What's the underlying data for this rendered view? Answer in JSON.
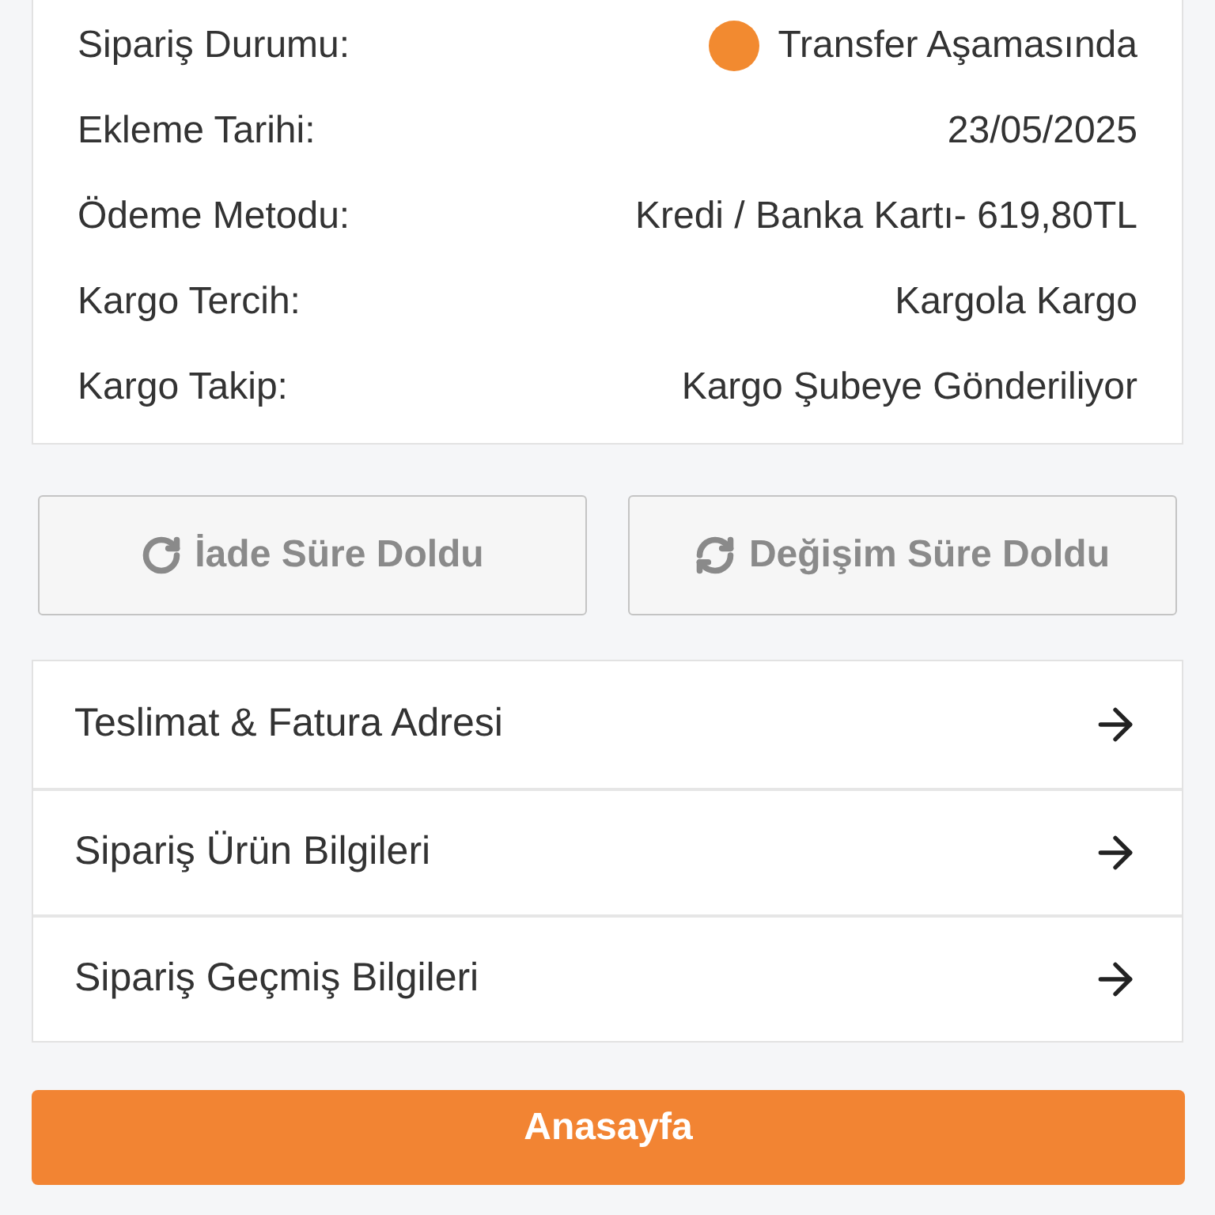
{
  "order_info": [
    {
      "label": "Sipariş Durumu:",
      "value": "Transfer Aşamasında",
      "kind": "status"
    },
    {
      "label": "Ekleme Tarihi:",
      "value": "23/05/2025",
      "kind": "text"
    },
    {
      "label": "Ödeme Metodu:",
      "value": "Kredi / Banka Kartı- 619,80TL",
      "kind": "text"
    },
    {
      "label": "Kargo Tercih:",
      "value": "Kargola Kargo",
      "kind": "text"
    },
    {
      "label": "Kargo Takip:",
      "value": "Kargo Şubeye Gönderiliyor",
      "kind": "text"
    }
  ],
  "actions": [
    {
      "label": "İade Süre Doldu",
      "disabled": true,
      "kind": "return"
    },
    {
      "label": "Değişim Süre Doldu",
      "disabled": true,
      "kind": "exchange"
    }
  ],
  "links": [
    "Teslimat & Fatura Adresi",
    "Sipariş Ürün Bilgileri",
    "Sipariş Geçmiş Bilgileri"
  ],
  "home_button": "Anasayfa"
}
